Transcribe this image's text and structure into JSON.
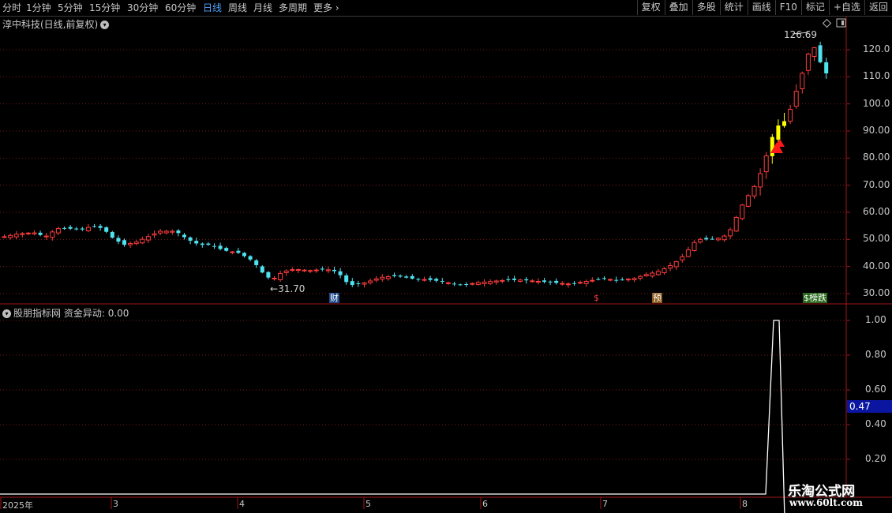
{
  "toolbar": {
    "periods": [
      "分时",
      "1分钟",
      "5分钟",
      "15分钟",
      "30分钟",
      "60分钟",
      "日线",
      "周线",
      "月线",
      "多周期",
      "更多"
    ],
    "active_period": "日线",
    "actions": [
      "复权",
      "叠加",
      "多股",
      "统计",
      "画线",
      "F10",
      "标记",
      "+自选",
      "返回"
    ]
  },
  "main_title": "淳中科技(日线,前复权)",
  "main_axis_ticks": [
    "120.0",
    "110.0",
    "100.0",
    "90.00",
    "80.00",
    "70.00",
    "60.00",
    "50.00",
    "40.00",
    "30.00"
  ],
  "high_label": "126.69",
  "low_label": "31.70",
  "event_tags": {
    "cai": "财",
    "s": "$",
    "yu": "预",
    "bang": "$榜跌"
  },
  "indicator": {
    "title": "股朋指标网",
    "line_name": "资金异动",
    "line_value": "0.00",
    "axis_ticks": [
      "1.00",
      "0.80",
      "0.60",
      "0.40",
      "0.20"
    ],
    "current_value": "0.47"
  },
  "time_axis": [
    "2025年",
    "3",
    "4",
    "5",
    "6",
    "7",
    "8"
  ],
  "watermark": {
    "line1": "乐淘公式网",
    "line2": "www.60lt.com"
  },
  "colors": {
    "up": "#ff3c3c",
    "down": "#4fe3ef",
    "signal": "#ffff00",
    "grid": "#7a1c1c",
    "axis": "#a01818",
    "indicator_line": "#ffffff",
    "highlight": "#0a16a0"
  },
  "chart_data": {
    "type": "candlestick",
    "price_ylim": [
      27,
      131
    ],
    "high": 126.69,
    "low": 31.7,
    "indicator_values_tail": [
      0,
      0,
      0,
      0,
      1,
      1,
      0
    ],
    "indicator_ylim": [
      0,
      1.05
    ]
  }
}
